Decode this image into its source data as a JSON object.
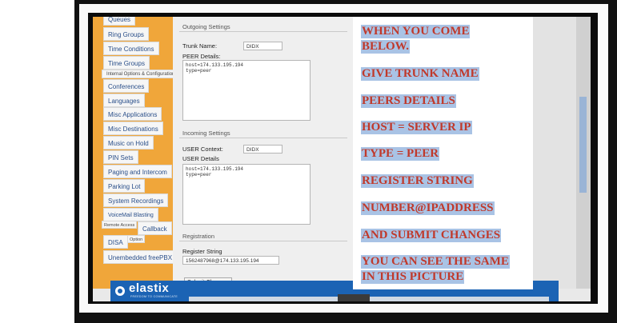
{
  "sidebar": {
    "items": [
      {
        "label": "Queues"
      },
      {
        "label": "Ring Groups"
      },
      {
        "label": "Time Conditions"
      },
      {
        "label": "Time Groups"
      },
      {
        "label": "Internal Options & Configuration"
      },
      {
        "label": "Conferences"
      },
      {
        "label": "Languages"
      },
      {
        "label": "Misc Applications"
      },
      {
        "label": "Misc Destinations"
      },
      {
        "label": "Music on Hold"
      },
      {
        "label": "PIN Sets"
      },
      {
        "label": "Paging and Intercom"
      },
      {
        "label": "Parking Lot"
      },
      {
        "label": "System Recordings"
      },
      {
        "label": "VoiceMail Blasting"
      },
      {
        "label": "Remote Access"
      },
      {
        "label": "Callback"
      },
      {
        "label": "DISA"
      },
      {
        "label": "Option"
      },
      {
        "label": "Unembedded freePBX"
      }
    ]
  },
  "form": {
    "outgoing_title": "Outgoing Settings",
    "trunk_name_label": "Trunk Name:",
    "trunk_name_value": "DIDX",
    "peer_details_label": "PEER Details:",
    "peer_details_value": "host=174.133.195.194\ntype=peer",
    "incoming_title": "Incoming Settings",
    "user_context_label": "USER Context:",
    "user_context_value": "DIDX",
    "user_details_label": "USER Details",
    "user_details_value": "host=174.133.195.194\ntype=peer",
    "registration_title": "Registration",
    "register_string_label": "Register String",
    "register_string_value": "1562487968@174.133.195.194",
    "submit_label": "Submit Changes"
  },
  "banner": {
    "logo_text": "elastix",
    "logo_tagline": "FREEDOM TO COMMUNICATE"
  },
  "overlay": {
    "lines": [
      "WHEN YOU COME",
      "BELOW.",
      "GIVE TRUNK NAME",
      "PEERS DETAILS",
      "HOST = SERVER IP",
      "TYPE = PEER",
      "REGISTER STRING",
      "NUMBER@IPADDRESS",
      "AND SUBMIT CHANGES",
      "YOU CAN SEE THE SAME",
      "IN THIS  PICTURE"
    ],
    "text_color": "#c0392b",
    "highlight_color": "#a9c3e5"
  }
}
